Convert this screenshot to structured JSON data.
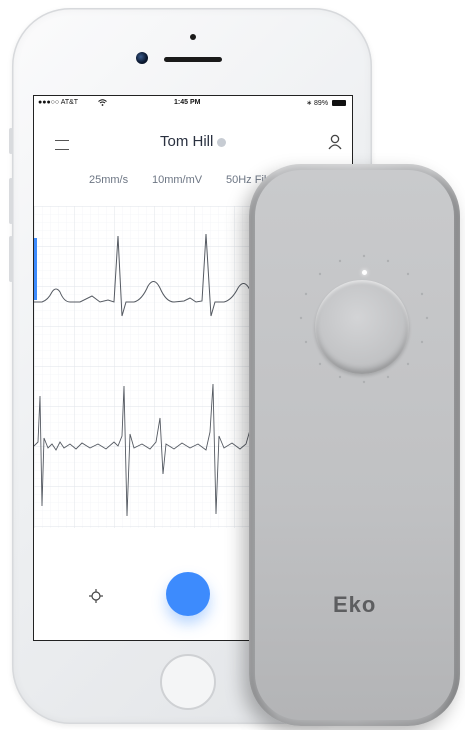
{
  "status_bar": {
    "carrier": "●●●○○ AT&T",
    "time": "1:45 PM",
    "battery": "89%",
    "icons": [
      "wifi-icon",
      "bluetooth-icon",
      "battery-icon"
    ]
  },
  "header": {
    "title": "Tom Hill",
    "icons": [
      "menu-icon",
      "user-icon"
    ]
  },
  "settings": {
    "paper_speed": "25mm/s",
    "gain": "10mm/mV",
    "filter": "50Hz Fil"
  },
  "controls": {
    "icons": [
      "target-icon",
      "record-button"
    ]
  },
  "device": {
    "brand": "Eko"
  },
  "colors": {
    "accent": "#3d8bfd",
    "trace": "#555a62",
    "grid": "#e6e9ee"
  }
}
